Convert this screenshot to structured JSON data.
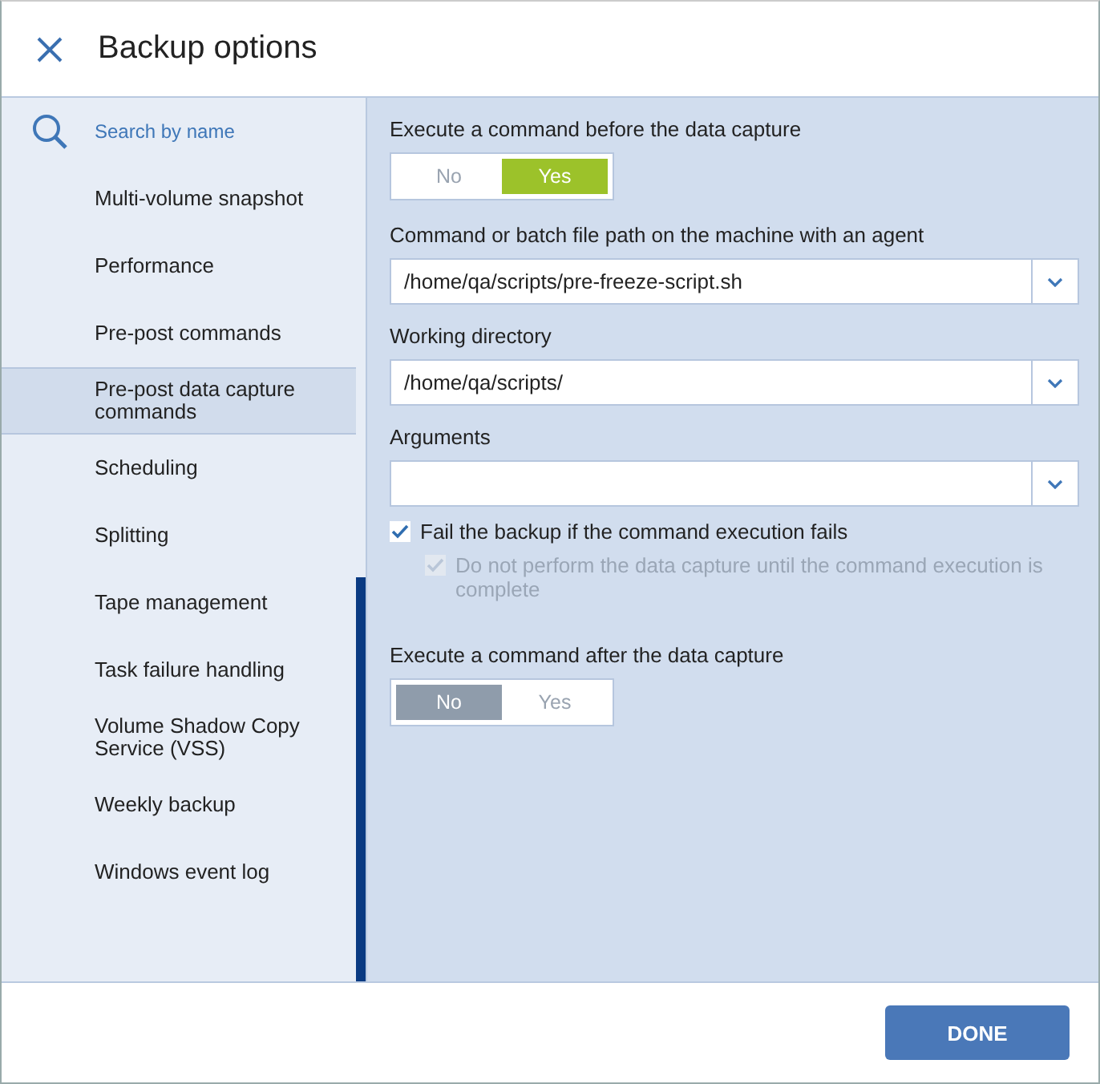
{
  "header": {
    "title": "Backup options"
  },
  "sidebar": {
    "search": {
      "placeholder": "Search by name"
    },
    "items": [
      {
        "label": "Multi-volume snapshot",
        "selected": false
      },
      {
        "label": "Performance",
        "selected": false
      },
      {
        "label": "Pre-post commands",
        "selected": false
      },
      {
        "label": "Pre-post data capture commands",
        "selected": true
      },
      {
        "label": "Scheduling",
        "selected": false
      },
      {
        "label": "Splitting",
        "selected": false
      },
      {
        "label": "Tape management",
        "selected": false
      },
      {
        "label": "Task failure handling",
        "selected": false
      },
      {
        "label": "Volume Shadow Copy Service (VSS)",
        "selected": false
      },
      {
        "label": "Weekly backup",
        "selected": false
      },
      {
        "label": "Windows event log",
        "selected": false
      }
    ]
  },
  "content": [
    {
      "kind": "toggle",
      "label": "Execute a command before the data capture",
      "options": [
        {
          "label": "No",
          "kind": "negative",
          "selected": false
        },
        {
          "label": "Yes",
          "kind": "positive",
          "selected": true
        }
      ]
    },
    {
      "kind": "combo",
      "label": "Command or batch file path on the machine with an agent",
      "value": "/home/qa/scripts/pre-freeze-script.sh"
    },
    {
      "kind": "combo",
      "label": "Working directory",
      "value": "/home/qa/scripts/"
    },
    {
      "kind": "combo",
      "label": "Arguments"
    },
    {
      "kind": "checkbox",
      "label": "Fail the backup if the command execution fails",
      "checked": true,
      "disabled": false
    },
    {
      "kind": "sub_checkbox",
      "label": "Do not perform the data capture until the command execution is complete",
      "checked": true,
      "disabled": true
    },
    {
      "kind": "toggle",
      "label": "Execute a command after the data capture",
      "options": [
        {
          "label": "No",
          "kind": "negative",
          "selected": true
        },
        {
          "label": "Yes",
          "kind": "positive",
          "selected": false
        }
      ]
    }
  ],
  "footer": {
    "button": "DONE"
  }
}
